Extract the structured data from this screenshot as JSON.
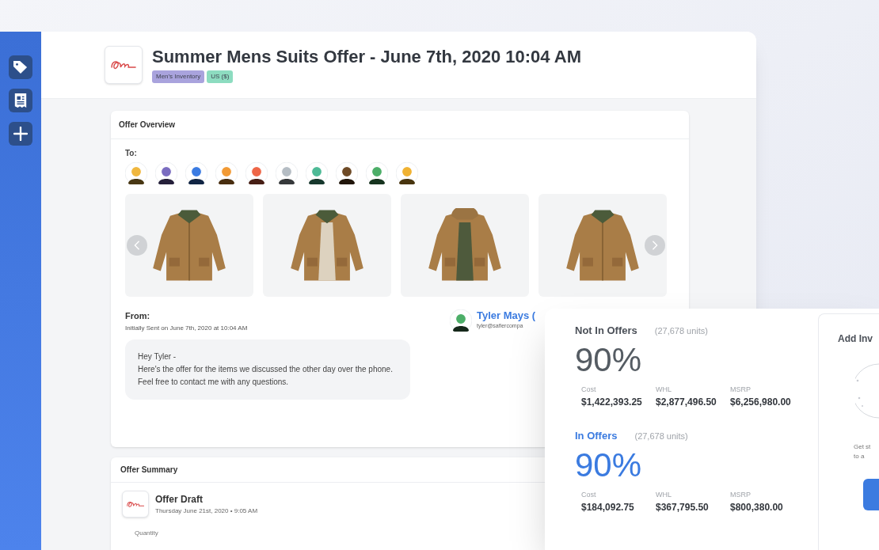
{
  "header": {
    "title": "Summer Mens Suits Offer - June 7th, 2020 10:04 AM",
    "tags": [
      {
        "label": "Men's Inventory",
        "color": "#a9a3dd"
      },
      {
        "label": "US ($)",
        "color": "#8ddcc0"
      }
    ]
  },
  "offer_overview": {
    "title": "Offer Overview",
    "to_label": "To:",
    "recipients": [
      {
        "color": "#f0b73e"
      },
      {
        "color": "#7a6cc0"
      },
      {
        "color": "#3a7be2"
      },
      {
        "color": "#f29a34"
      },
      {
        "color": "#ee6647"
      },
      {
        "color": "#b5bdc4"
      },
      {
        "color": "#4dba96"
      },
      {
        "color": "#6e4a26"
      },
      {
        "color": "#4cae68"
      },
      {
        "color": "#f0b232"
      }
    ],
    "from": {
      "label": "From:",
      "sent": "Initially Sent on June 7th, 2020 at 10:04 AM",
      "message": "Hey Tyler -\nHere's the offer for the items we discussed the other day over the phone. Feel free to contact me with any questions."
    },
    "sender": {
      "name": "Tyler Mays (",
      "email": "tyler@safiercompa"
    }
  },
  "offer_summary": {
    "title": "Offer Summary",
    "draft": {
      "title": "Offer Draft",
      "date": "Thursday June 21st, 2020 • 9:05 AM"
    },
    "quantity_label": "Quantity"
  },
  "stats": {
    "groups": [
      {
        "label": "Not In Offers",
        "units": "(27,678 units)",
        "percent": "90%",
        "selected": false,
        "metrics": [
          {
            "label": "Cost",
            "value": "$1,422,393.25"
          },
          {
            "label": "WHL",
            "value": "$2,877,496.50"
          },
          {
            "label": "MSRP",
            "value": "$6,256,980.00"
          }
        ]
      },
      {
        "label": "In Offers",
        "units": "(27,678 units)",
        "percent": "90%",
        "selected": true,
        "metrics": [
          {
            "label": "Cost",
            "value": "$184,092.75"
          },
          {
            "label": "WHL",
            "value": "$367,795.50"
          },
          {
            "label": "MSRP",
            "value": "$800,380.00"
          }
        ]
      }
    ]
  },
  "add_inventory": {
    "title": "Add Inv",
    "hint": "Get st\nto a"
  }
}
